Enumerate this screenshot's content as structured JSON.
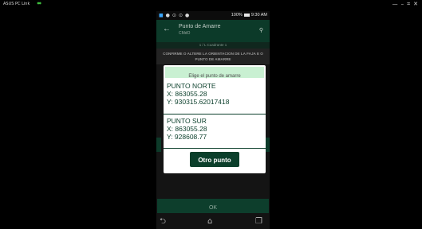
{
  "pc_link": {
    "title": "ASUS PC Link",
    "window_controls": [
      "—",
      "–",
      "⌗",
      "✕"
    ]
  },
  "status_bar": {
    "left_icons": [
      "■",
      "●",
      "⊙",
      "⊙",
      "●"
    ],
    "battery": "100%",
    "time": "9:30 AM"
  },
  "app_bar": {
    "title": "Punto de Amarre",
    "subtitle": "CMdO",
    "back_icon": "←",
    "pin_icon": "⚲"
  },
  "tab_label": "1 / L Cuadrante 1",
  "confirm_text": "CONFIRME O ALTERE LA ORIENTACION DE LA FAJA E O PUNTO DE AMARRE",
  "dialog": {
    "header": "Elige el punto de amarre",
    "options": [
      {
        "name": "PUNTO NORTE",
        "x": "X: 863055.28",
        "y": "Y: 930315.62017418"
      },
      {
        "name": "PUNTO SUR",
        "x": "X: 863055.28",
        "y": "Y: 928608.77"
      }
    ],
    "other_button": "Otro punto"
  },
  "ok_button": "OK",
  "nav": {
    "back": "⮌",
    "home": "⌂",
    "recents": "❐"
  },
  "colors": {
    "app_green": "#0c3a29",
    "dialog_header": "#c9f0d2",
    "text_green": "#0b3f2b",
    "conn_green": "#3fbf3f"
  }
}
